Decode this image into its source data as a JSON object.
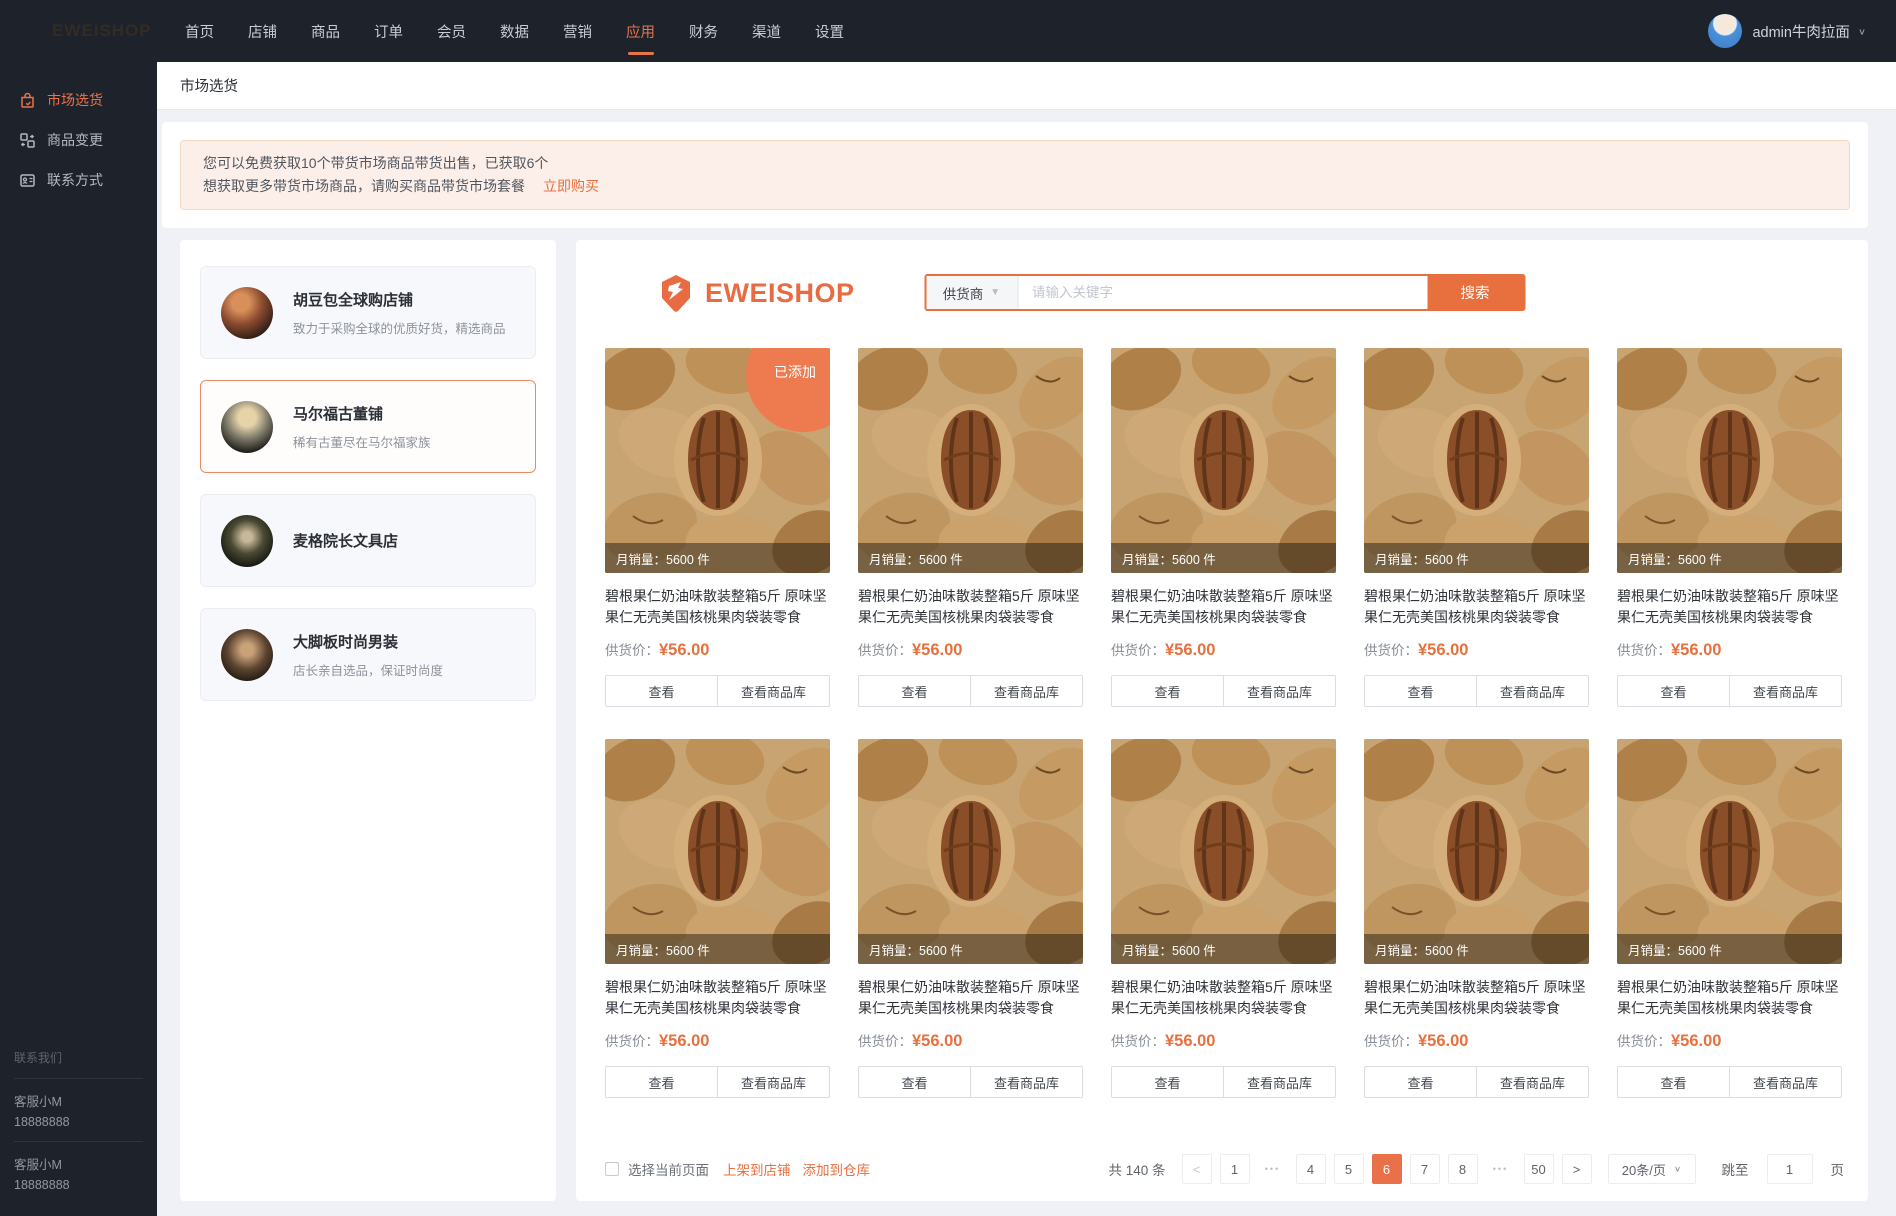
{
  "colors": {
    "accent": "#e8703f",
    "dark_bg": "#1e222b",
    "active_page_bg": "#e97048",
    "banner_bg": "#fcefe9"
  },
  "topbar": {
    "logo": "EWEISHOP",
    "nav": [
      {
        "label": "首页",
        "active": false
      },
      {
        "label": "店铺",
        "active": false
      },
      {
        "label": "商品",
        "active": false
      },
      {
        "label": "订单",
        "active": false
      },
      {
        "label": "会员",
        "active": false
      },
      {
        "label": "数据",
        "active": false
      },
      {
        "label": "营销",
        "active": false
      },
      {
        "label": "应用",
        "active": true
      },
      {
        "label": "财务",
        "active": false
      },
      {
        "label": "渠道",
        "active": false
      },
      {
        "label": "设置",
        "active": false
      }
    ],
    "user": {
      "name": "admin牛肉拉面"
    }
  },
  "sidebar": {
    "items": [
      {
        "label": "市场选货",
        "active": true
      },
      {
        "label": "商品变更",
        "active": false
      },
      {
        "label": "联系方式",
        "active": false
      }
    ],
    "footer": {
      "title": "联系我们",
      "contacts": [
        {
          "name": "客服小M",
          "phone": "18888888"
        },
        {
          "name": "客服小M",
          "phone": "18888888"
        }
      ]
    }
  },
  "breadcrumb": "市场选货",
  "banner": {
    "line1": "您可以免费获取10个带货市场商品带货出售，已获取6个",
    "line2": "想获取更多带货市场商品，请购买商品带货市场套餐",
    "link": "立即购买"
  },
  "shops": [
    {
      "name": "胡豆包全球购店铺",
      "desc": "致力于采购全球的优质好货，精选商品",
      "selected": false
    },
    {
      "name": "马尔福古董铺",
      "desc": "稀有古董尽在马尔福家族",
      "selected": true
    },
    {
      "name": "麦格院长文具店",
      "desc": "",
      "selected": false
    },
    {
      "name": "大脚板时尚男装",
      "desc": "店长亲自选品，保证时尚度",
      "selected": false
    }
  ],
  "market": {
    "brand": "EWEISHOP",
    "search": {
      "filter_label": "供货商",
      "placeholder": "请输入关键字",
      "button": "搜索"
    }
  },
  "product": {
    "title": "碧根果仁奶油味散装整箱5斤 原味坚果仁无壳美国核桃果肉袋装零食",
    "sales_label": "月销量：",
    "sales_value": "5600 件",
    "price_label": "供货价：",
    "price": "¥56.00",
    "view_button": "查看",
    "view_lib_button": "查看商品库",
    "added_badge": "已添加"
  },
  "grid": {
    "cards": [
      {
        "added": true
      },
      {
        "added": false
      },
      {
        "added": false
      },
      {
        "added": false
      },
      {
        "added": false
      },
      {
        "added": false
      },
      {
        "added": false
      },
      {
        "added": false
      },
      {
        "added": false
      },
      {
        "added": false
      }
    ]
  },
  "footer_bar": {
    "select_page": "选择当前页面",
    "publish": "上架到店铺",
    "add_warehouse": "添加到仓库",
    "total": "共 140 条",
    "pages": [
      "1",
      "•••",
      "4",
      "5",
      "6",
      "7",
      "8",
      "•••",
      "50"
    ],
    "active_page": "6",
    "page_size": "20条/页",
    "jump_label": "跳至",
    "jump_value": "1",
    "jump_suffix": "页"
  }
}
